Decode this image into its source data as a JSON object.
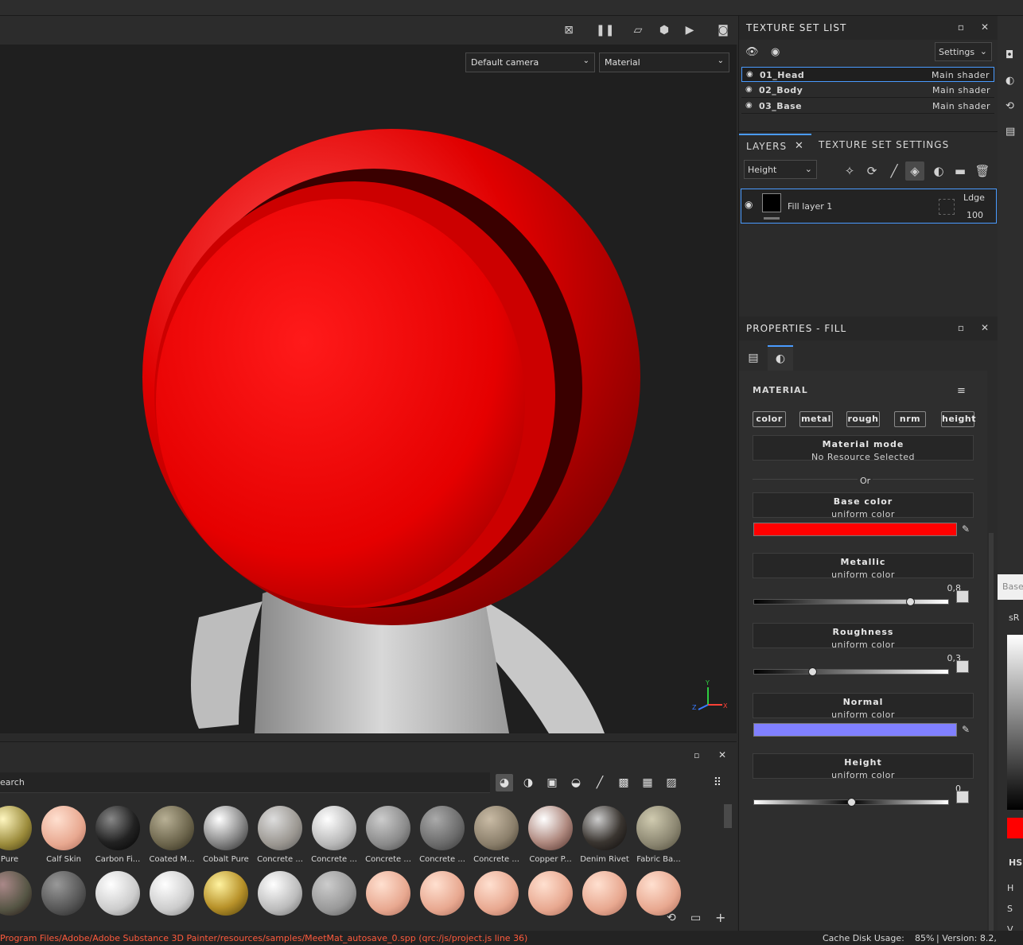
{
  "viewport": {
    "camera_select": "Default camera",
    "mode_select": "Material",
    "axis_labels": {
      "y": "Y",
      "z": "Z",
      "x": "X"
    }
  },
  "texture_set_list": {
    "title": "TEXTURE SET LIST",
    "settings_label": "Settings",
    "rows": [
      {
        "name": "01_Head",
        "shader": "Main shader"
      },
      {
        "name": "02_Body",
        "shader": "Main shader"
      },
      {
        "name": "03_Base",
        "shader": "Main shader"
      }
    ]
  },
  "layers": {
    "tab_layers": "LAYERS",
    "tab_texture_settings": "TEXTURE SET SETTINGS",
    "channel_select": "Height",
    "layer": {
      "name": "Fill layer 1",
      "blend": "Ldge",
      "opacity": "100"
    }
  },
  "properties": {
    "title": "PROPERTIES - FILL",
    "section": "MATERIAL",
    "chips": [
      "color",
      "metal",
      "rough",
      "nrm",
      "height"
    ],
    "material_mode": {
      "title": "Material mode",
      "sub": "No Resource Selected"
    },
    "or_label": "Or",
    "base_color": {
      "title": "Base color",
      "sub": "uniform color",
      "color": "#ff0000"
    },
    "metallic": {
      "title": "Metallic",
      "sub": "uniform color",
      "value": "0,8",
      "fraction": 0.8
    },
    "roughness": {
      "title": "Roughness",
      "sub": "uniform color",
      "value": "0,3",
      "fraction": 0.3
    },
    "normal": {
      "title": "Normal",
      "sub": "uniform color",
      "color": "#8080ff"
    },
    "height": {
      "title": "Height",
      "sub": "uniform color",
      "value": "0",
      "fraction": 0.5
    }
  },
  "shelf": {
    "search_placeholder": "earch",
    "materials_row1": [
      "Pure",
      "Calf Skin",
      "Carbon Fi...",
      "Coated M...",
      "Cobalt Pure",
      "Concrete ...",
      "Concrete ...",
      "Concrete ...",
      "Concrete ...",
      "Concrete ...",
      "Copper P...",
      "Denim Rivet",
      "Fabric Ba..."
    ]
  },
  "far_right": {
    "base_label": "Base",
    "srgb_label": "sR",
    "hs_label": "HS",
    "h": "H",
    "s": "S",
    "v": "V"
  },
  "status": {
    "path": "Program Files/Adobe/Adobe Substance 3D Painter/resources/samples/MeetMat_autosave_0.spp (qrc:/js/project.js line 36)",
    "cache": "Cache Disk Usage:",
    "cache_value": "85%",
    "version": "| Version: 8.2,"
  }
}
